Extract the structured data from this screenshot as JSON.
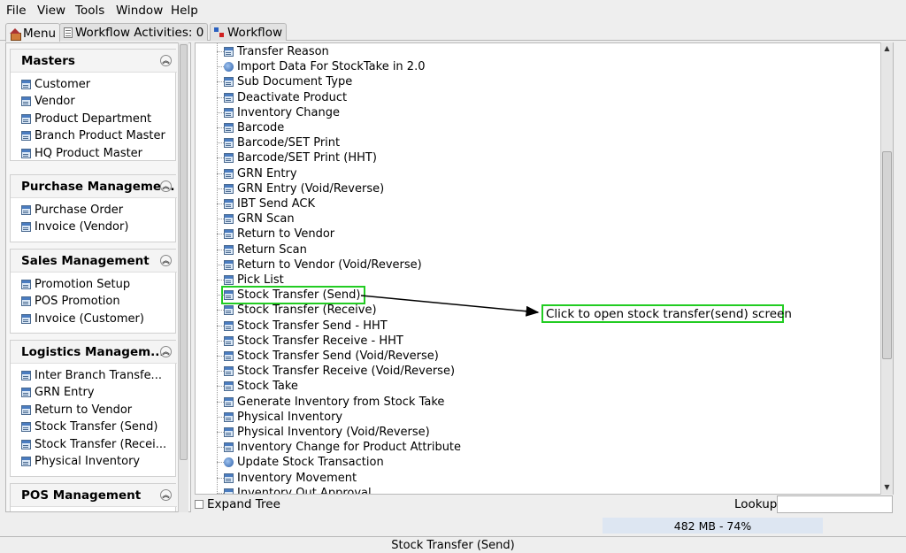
{
  "menubar": {
    "items": [
      "File",
      "View",
      "Tools",
      "Window",
      "Help"
    ]
  },
  "tabs": {
    "menu": "Menu",
    "activities": "Workflow Activities: 0",
    "workflow": "Workflow"
  },
  "sections": {
    "masters": {
      "title": "Masters",
      "items": [
        "Customer",
        "Vendor",
        "Product Department",
        "Branch Product Master",
        "HQ Product Master"
      ]
    },
    "purchase": {
      "title": "Purchase Manageme...",
      "items": [
        "Purchase Order",
        "Invoice (Vendor)"
      ]
    },
    "sales": {
      "title": "Sales Management",
      "items": [
        "Promotion Setup",
        "POS Promotion",
        "Invoice (Customer)"
      ]
    },
    "logistics": {
      "title": "Logistics Managem...",
      "items": [
        "Inter Branch Transfe...",
        "GRN Entry",
        "Return to Vendor",
        "Stock Transfer (Send)",
        "Stock Transfer (Recei...",
        "Physical Inventory"
      ]
    },
    "pos": {
      "title": "POS Management"
    }
  },
  "tree": {
    "items": [
      {
        "label": "Transfer Reason",
        "icon": "form-icon"
      },
      {
        "label": "Import Data For StockTake in 2.0",
        "icon": "globe-icon"
      },
      {
        "label": "Sub Document Type",
        "icon": "form-icon"
      },
      {
        "label": "Deactivate Product",
        "icon": "form-icon"
      },
      {
        "label": "Inventory Change",
        "icon": "form-icon"
      },
      {
        "label": "Barcode",
        "icon": "form-icon"
      },
      {
        "label": "Barcode/SET Print",
        "icon": "form-icon"
      },
      {
        "label": "Barcode/SET Print (HHT)",
        "icon": "form-icon"
      },
      {
        "label": "GRN Entry",
        "icon": "form-icon"
      },
      {
        "label": "GRN Entry (Void/Reverse)",
        "icon": "form-icon"
      },
      {
        "label": "IBT Send ACK",
        "icon": "form-icon"
      },
      {
        "label": "GRN Scan",
        "icon": "form-icon"
      },
      {
        "label": "Return to Vendor",
        "icon": "form-icon"
      },
      {
        "label": "Return Scan",
        "icon": "form-icon"
      },
      {
        "label": "Return to Vendor (Void/Reverse)",
        "icon": "form-icon"
      },
      {
        "label": "Pick List",
        "icon": "form-icon"
      },
      {
        "label": "Stock Transfer (Send)",
        "icon": "form-icon"
      },
      {
        "label": "Stock Transfer (Receive)",
        "icon": "form-icon"
      },
      {
        "label": "Stock Transfer Send - HHT",
        "icon": "form-icon"
      },
      {
        "label": "Stock Transfer Receive - HHT",
        "icon": "form-icon"
      },
      {
        "label": "Stock Transfer Send (Void/Reverse)",
        "icon": "form-icon"
      },
      {
        "label": "Stock Transfer Receive (Void/Reverse)",
        "icon": "form-icon"
      },
      {
        "label": "Stock Take",
        "icon": "form-icon"
      },
      {
        "label": "Generate Inventory from Stock Take",
        "icon": "form-icon"
      },
      {
        "label": "Physical Inventory",
        "icon": "form-icon"
      },
      {
        "label": "Physical Inventory (Void/Reverse)",
        "icon": "form-icon"
      },
      {
        "label": "Inventory Change for Product Attribute",
        "icon": "form-icon"
      },
      {
        "label": "Update Stock Transaction",
        "icon": "globe-icon"
      },
      {
        "label": "Inventory Movement",
        "icon": "form-icon"
      },
      {
        "label": "Inventory Out Approval",
        "icon": "form-icon"
      }
    ]
  },
  "annotation": {
    "text": "Click to open stock transfer(send) screen"
  },
  "bottom": {
    "expand_tree": "Expand Tree",
    "lookup": "Lookup",
    "lookup_value": ""
  },
  "memory": "482 MB - 74%",
  "status": "Stock Transfer (Send)",
  "colors": {
    "highlight": "#22cc22",
    "memory_bg": "#dde6f2"
  }
}
